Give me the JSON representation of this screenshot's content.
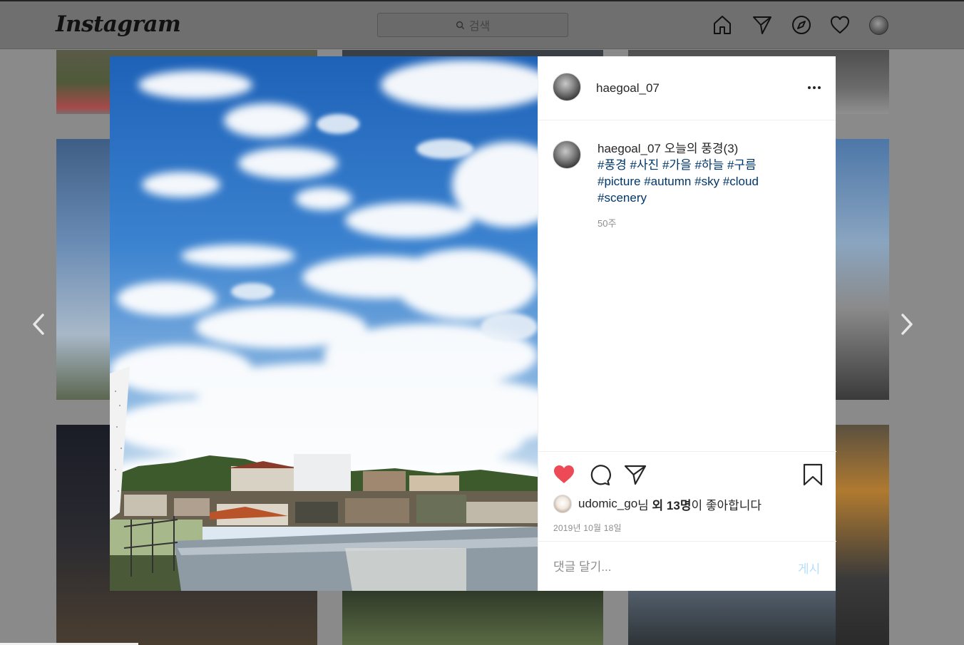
{
  "header": {
    "logo": "Instagram",
    "search_placeholder": "검색",
    "icons": [
      "home-icon",
      "direct-icon",
      "explore-icon",
      "activity-heart-icon",
      "profile-avatar"
    ]
  },
  "post": {
    "username": "haegoal_07",
    "caption_text": "오늘의 풍경(3)",
    "hashtags_line1": [
      "#풍경",
      "#사진",
      "#가을",
      "#하늘",
      "#구름"
    ],
    "hashtags_line2": [
      "#picture",
      "#autumn",
      "#sky",
      "#cloud"
    ],
    "hashtags_line3": [
      "#scenery"
    ],
    "caption_time": "50주",
    "likes": {
      "liker": "udomic_go",
      "suffix_nim": "님 ",
      "others": "외 13명",
      "tail": "이 좋아합니다"
    },
    "date": "2019년 10월 18일",
    "comment_placeholder": "댓글 달기...",
    "post_button": "게시"
  },
  "colors": {
    "liked_heart": "#ed4956",
    "hashtag": "#00376b",
    "post_button_disabled": "#b3dffc"
  }
}
